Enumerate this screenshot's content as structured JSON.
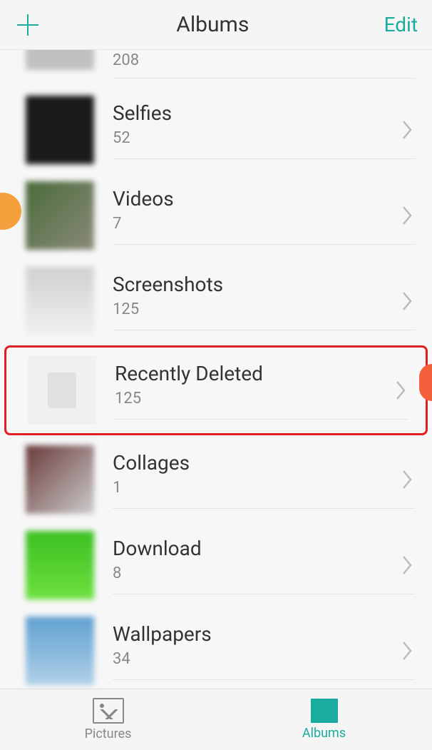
{
  "header": {
    "title": "Albums",
    "edit_label": "Edit"
  },
  "albums": [
    {
      "name": "",
      "count": "208",
      "thumb_class": "thumb-gray",
      "partial": true
    },
    {
      "name": "Selfies",
      "count": "52",
      "thumb_class": "thumb-dark"
    },
    {
      "name": "Videos",
      "count": "7",
      "thumb_class": "thumb-people"
    },
    {
      "name": "Screenshots",
      "count": "125",
      "thumb_class": "thumb-screen"
    },
    {
      "name": "Recently Deleted",
      "count": "125",
      "thumb_class": "thumb-blank",
      "highlighted": true
    },
    {
      "name": "Collages",
      "count": "1",
      "thumb_class": "thumb-collage"
    },
    {
      "name": "Download",
      "count": "8",
      "thumb_class": "thumb-green"
    },
    {
      "name": "Wallpapers",
      "count": "34",
      "thumb_class": "thumb-blue"
    }
  ],
  "nav": {
    "pictures_label": "Pictures",
    "albums_label": "Albums"
  },
  "colors": {
    "accent": "#1aac9e",
    "highlight_border": "#e02020"
  }
}
